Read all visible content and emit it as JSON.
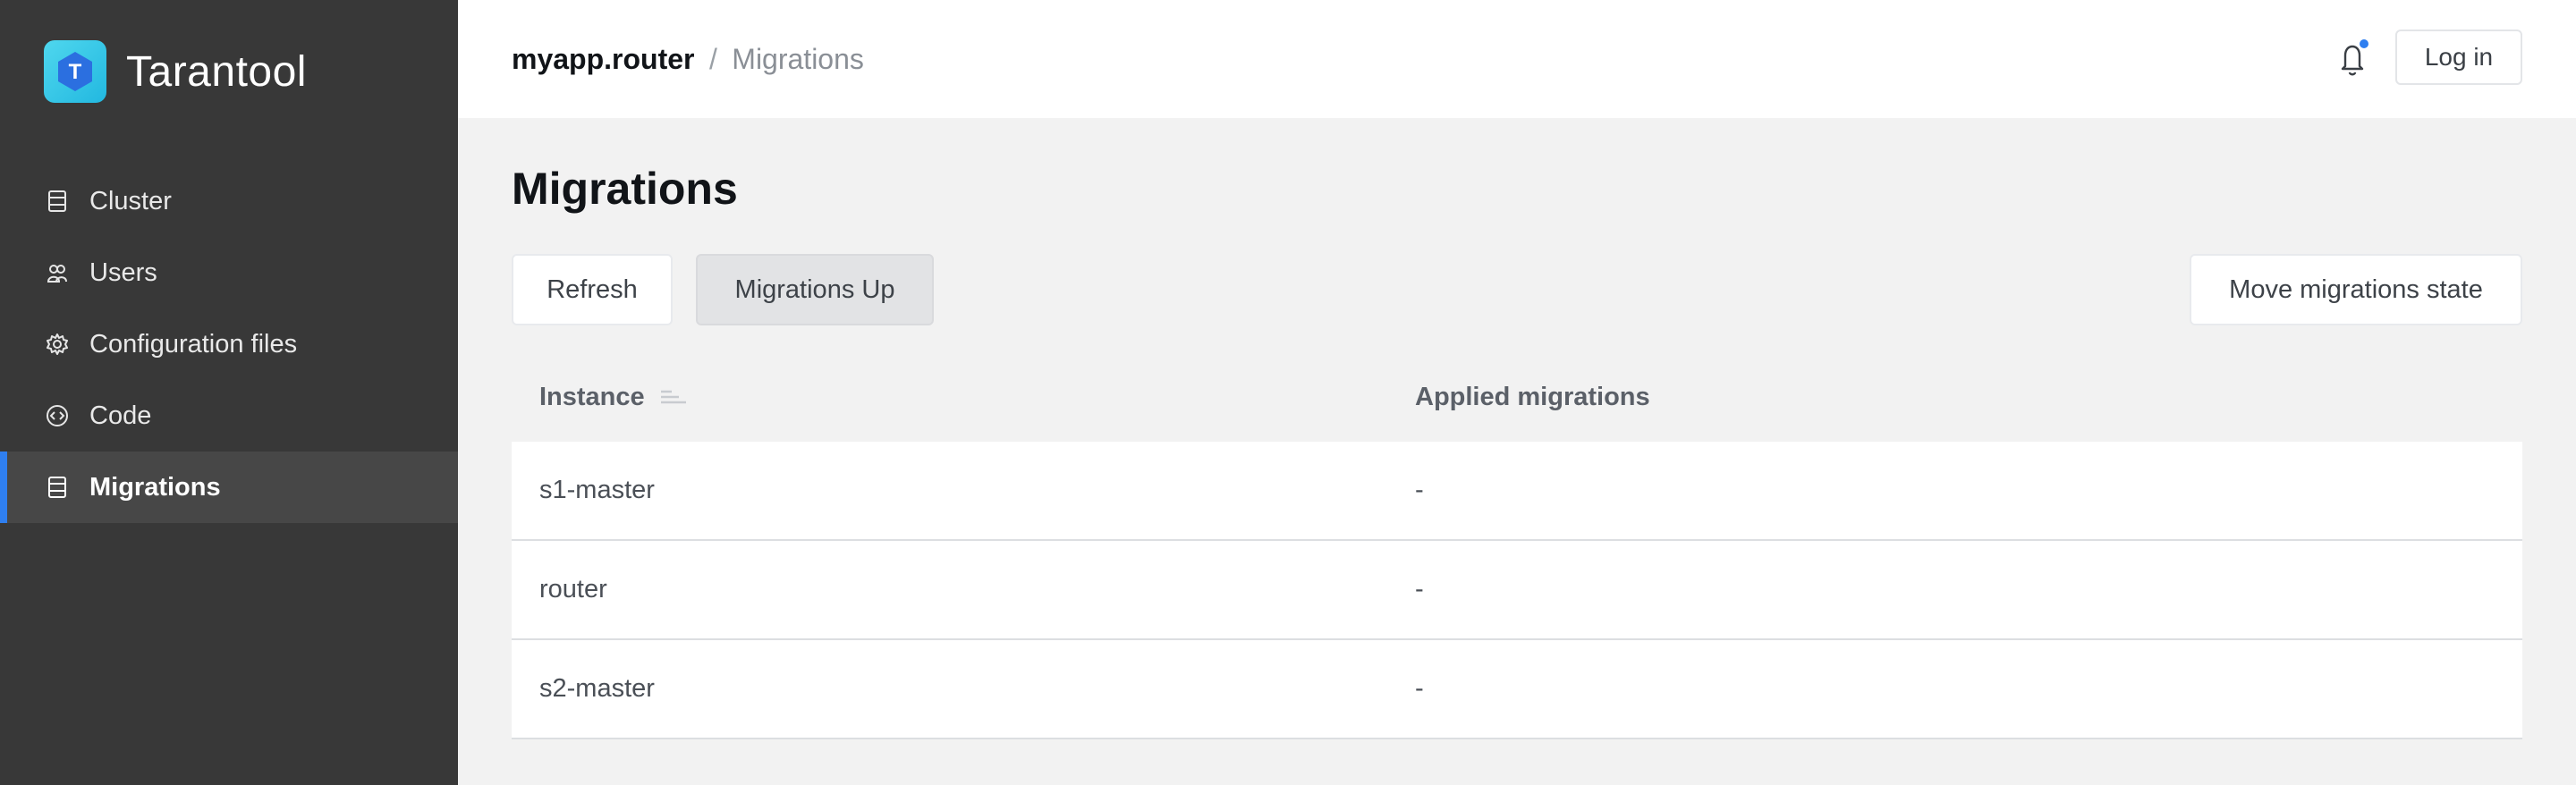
{
  "brand": {
    "name": "Tarantool",
    "logo_letter": "T"
  },
  "sidebar": {
    "items": [
      {
        "label": "Cluster",
        "icon": "server-icon",
        "active": false
      },
      {
        "label": "Users",
        "icon": "users-icon",
        "active": false
      },
      {
        "label": "Configuration files",
        "icon": "gear-icon",
        "active": false
      },
      {
        "label": "Code",
        "icon": "code-icon",
        "active": false
      },
      {
        "label": "Migrations",
        "icon": "server-icon",
        "active": true
      }
    ]
  },
  "header": {
    "breadcrumb_app": "myapp.router",
    "breadcrumb_separator": "/",
    "breadcrumb_page": "Migrations",
    "login_label": "Log in"
  },
  "page": {
    "title": "Migrations",
    "refresh_label": "Refresh",
    "migrations_up_label": "Migrations Up",
    "move_state_label": "Move migrations state"
  },
  "table": {
    "columns": [
      "Instance",
      "Applied migrations"
    ],
    "rows": [
      {
        "instance": "s1-master",
        "applied": "-"
      },
      {
        "instance": "router",
        "applied": "-"
      },
      {
        "instance": "s2-master",
        "applied": "-"
      }
    ]
  },
  "colors": {
    "accent": "#2f7ff0",
    "sidebar_bg": "#383838",
    "sidebar_active": "#474747",
    "logo": "#3fcbe8"
  }
}
